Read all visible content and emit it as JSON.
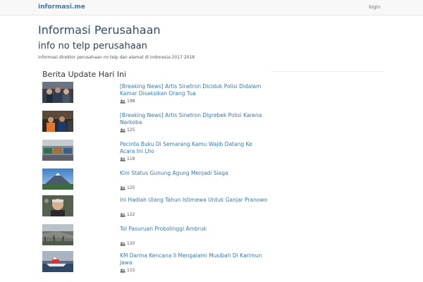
{
  "navbar": {
    "brand": "informasi.me",
    "login_label": "login"
  },
  "header": {
    "title": "Informasi Perusahaan",
    "subtitle": "info no telp perusahaan",
    "description": "informasi direktor perusahaan no telp dan alamat di indonesia 2017 2018"
  },
  "news": {
    "section_title": "Berita Update Hari Ini",
    "items": [
      {
        "title": "[Breaking News] Artis Sinetron Diciduk Polisi Didalam Kamar Disaksikan Orang Tua",
        "views": "198",
        "thumbnail": "police-crowd-photo"
      },
      {
        "title": "[Breaking News] Artis Sinetron Digrebek Polisi Karena Narkoba",
        "views": "125",
        "thumbnail": "arrest-photo"
      },
      {
        "title": "Pecinta Buku Di Semarang Kamu Wajib Datang Ke Acara Ini Lho",
        "views": "119",
        "thumbnail": "book-fair-photo"
      },
      {
        "title": "Kini Status Gunung Agung Menjadi Siaga",
        "views": "125",
        "thumbnail": "mountain-photo"
      },
      {
        "title": "Ini Hadiah Ulang Tahun Istimewa Untuk Ganjar Pranowo",
        "views": "122",
        "thumbnail": "portrait-photo"
      },
      {
        "title": "Tol Pasuruan Probolinggi Ambruk",
        "views": "120",
        "thumbnail": "collapsed-bridge-photo"
      },
      {
        "title": "KM Darma Kencana II Mengalami Musibah Di Karimun Jawa",
        "views": "115",
        "thumbnail": "ship-photo"
      }
    ]
  }
}
